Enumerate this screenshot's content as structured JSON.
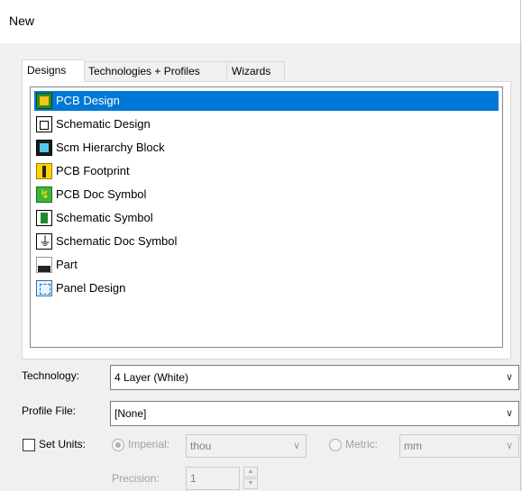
{
  "window": {
    "title": "New"
  },
  "tabs": [
    {
      "label": "Designs",
      "active": true
    },
    {
      "label": "Technologies + Profiles",
      "active": false
    },
    {
      "label": "Wizards",
      "active": false
    }
  ],
  "designs": {
    "items": [
      {
        "label": "PCB Design",
        "icon": "pcb-design-icon",
        "selected": true
      },
      {
        "label": "Schematic Design",
        "icon": "schematic-design-icon",
        "selected": false
      },
      {
        "label": "Scm Hierarchy Block",
        "icon": "hierarchy-block-icon",
        "selected": false
      },
      {
        "label": "PCB Footprint",
        "icon": "pcb-footprint-icon",
        "selected": false
      },
      {
        "label": "PCB Doc Symbol",
        "icon": "pcb-doc-symbol-icon",
        "selected": false
      },
      {
        "label": "Schematic Symbol",
        "icon": "schematic-symbol-icon",
        "selected": false
      },
      {
        "label": "Schematic Doc Symbol",
        "icon": "schematic-doc-symbol-icon",
        "selected": false
      },
      {
        "label": "Part",
        "icon": "part-icon",
        "selected": false
      },
      {
        "label": "Panel Design",
        "icon": "panel-design-icon",
        "selected": false
      }
    ]
  },
  "form": {
    "technology_label": "Technology:",
    "technology_value": "4 Layer (White)",
    "profile_label": "Profile File:",
    "profile_value": "[None]",
    "set_units_label": "Set Units:",
    "imperial_label": "Imperial:",
    "imperial_value": "thou",
    "metric_label": "Metric:",
    "metric_value": "mm",
    "precision_label": "Precision:",
    "precision_value": "1"
  },
  "colors": {
    "selection": "#0078d7",
    "window_bg": "#f0f0f0"
  }
}
